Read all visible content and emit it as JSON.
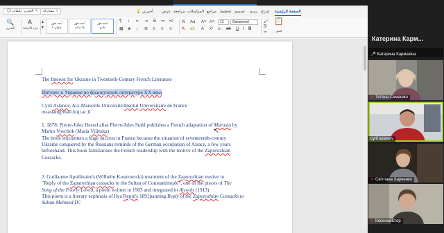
{
  "word": {
    "tabs": [
      {
        "label": "الصفحة الرئيسية",
        "active": true
      },
      {
        "label": "إدراج"
      },
      {
        "label": "رسم"
      },
      {
        "label": "تصميم"
      },
      {
        "label": "تخطيط"
      },
      {
        "label": "مراجع"
      },
      {
        "label": "المراسلات"
      },
      {
        "label": "مراجعة"
      },
      {
        "label": "عرض"
      },
      {
        "label": "أخبرني"
      }
    ],
    "right_buttons": {
      "comments": "التعليقات",
      "editing": "التحرير",
      "share": "مشاركة"
    },
    "ribbon": {
      "paste": "لصق",
      "font_name": "Garamond",
      "font_size": "12",
      "styles": [
        "أبجد هوز",
        "أبجد هوز",
        "أبجد هوز"
      ],
      "style_captions": [
        "عادي",
        "بلا تباعد",
        "عنوان 1"
      ],
      "styles_pane": "جزء الأنماط",
      "editing_label": "التحرير"
    },
    "document": {
      "title_parts": [
        "The ",
        "Interest for",
        " Ukraine in Twentieth-Century French Literature"
      ],
      "title_ua": "Интерес к Украине во французской литературе XX века",
      "author_line": [
        "Cyril ",
        "Aslanov",
        ", Aix-Marseille Université/",
        "Institut",
        " ",
        "Universitaire",
        " de France"
      ],
      "email": "msaslan@mail.huji.ac.il",
      "p1_l1": [
        "1. 1878: Pierre-Jules Herzel alias Pierre-Jules Stahl publishes a French adaptation of ",
        "Marusia",
        " by"
      ],
      "p1_l2": [
        "Marko ",
        "Vovchok",
        " (Maria ",
        "Vilinska",
        ")"
      ],
      "p1_l3": "The book encounters a huge success in France because the situation of seventeenth-century",
      "p1_l4": "Ukraine conquered by the Russians reminds of the German occupation of Alsace, a few years",
      "p1_l5": [
        "beforehand. This book familiarizes the French readership with the motive of the ",
        "Zaporozhian"
      ],
      "p1_l6": "Cossacks.",
      "p2_l1": [
        "2. Guillaume Apollinaire's (Wilhelm Kostrowicki) treatment of the ",
        "Zaporozhian",
        " motive in"
      ],
      "p2_l2": [
        "\"Reply of the ",
        "Zaparozhian",
        " ",
        "cossacks",
        " to the Sultan of Constantinople\", one of the pieces of ",
        "The"
      ],
      "p2_l3": [
        "Song of the Poorly Loved",
        ", a poem written in 1903 and integrated in ",
        "Alcools",
        " (1913)."
      ],
      "p2_l4": [
        "This poem is a literary ecphrasis of Ilya ",
        "Repin's",
        " 1891painting ",
        "Reply of the ",
        "Zaporozhian",
        " Cossacks to"
      ],
      "p2_l5": "Sultan Mehmed IV:"
    }
  },
  "video_panel": {
    "header": "Катерина  Карм...",
    "participants": [
      {
        "name": "Катерина Кармазіна",
        "muted": true
      },
      {
        "name": "Тетяна Семашко",
        "muted": true
      },
      {
        "name": "cyril aslanov",
        "muted": false,
        "active": true
      },
      {
        "name": "Світлана Харченко",
        "muted": true
      },
      {
        "name": "КасенюкЄгор",
        "muted": true
      }
    ]
  }
}
